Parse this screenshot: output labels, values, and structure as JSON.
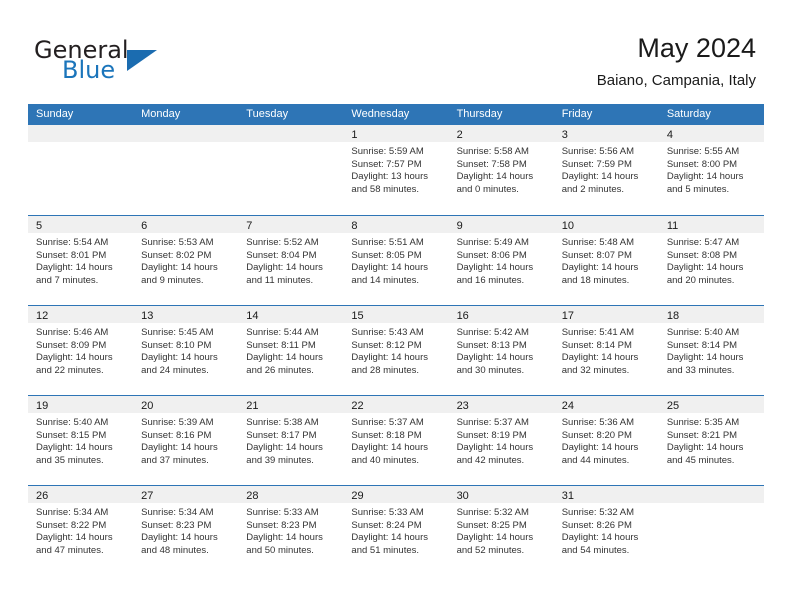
{
  "brand": {
    "word1": "General",
    "word2": "Blue",
    "logo_icon": "blue-triangle-icon"
  },
  "header": {
    "title": "May 2024",
    "subtitle": "Baiano, Campania, Italy"
  },
  "colors": {
    "header_blue": "#2e75b6",
    "brand_blue": "#1b75bb",
    "daynum_band": "#f0f0f0",
    "text": "#333333"
  },
  "calendar": {
    "day_headers": [
      "Sunday",
      "Monday",
      "Tuesday",
      "Wednesday",
      "Thursday",
      "Friday",
      "Saturday"
    ],
    "labels": {
      "sunrise": "Sunrise:",
      "sunset": "Sunset:",
      "daylight": "Daylight:"
    },
    "weeks": [
      [
        {
          "day": "",
          "empty": true
        },
        {
          "day": "",
          "empty": true
        },
        {
          "day": "",
          "empty": true
        },
        {
          "day": "1",
          "sunrise": "Sunrise: 5:59 AM",
          "sunset": "Sunset: 7:57 PM",
          "daylight1": "Daylight: 13 hours",
          "daylight2": "and 58 minutes."
        },
        {
          "day": "2",
          "sunrise": "Sunrise: 5:58 AM",
          "sunset": "Sunset: 7:58 PM",
          "daylight1": "Daylight: 14 hours",
          "daylight2": "and 0 minutes."
        },
        {
          "day": "3",
          "sunrise": "Sunrise: 5:56 AM",
          "sunset": "Sunset: 7:59 PM",
          "daylight1": "Daylight: 14 hours",
          "daylight2": "and 2 minutes."
        },
        {
          "day": "4",
          "sunrise": "Sunrise: 5:55 AM",
          "sunset": "Sunset: 8:00 PM",
          "daylight1": "Daylight: 14 hours",
          "daylight2": "and 5 minutes."
        }
      ],
      [
        {
          "day": "5",
          "sunrise": "Sunrise: 5:54 AM",
          "sunset": "Sunset: 8:01 PM",
          "daylight1": "Daylight: 14 hours",
          "daylight2": "and 7 minutes."
        },
        {
          "day": "6",
          "sunrise": "Sunrise: 5:53 AM",
          "sunset": "Sunset: 8:02 PM",
          "daylight1": "Daylight: 14 hours",
          "daylight2": "and 9 minutes."
        },
        {
          "day": "7",
          "sunrise": "Sunrise: 5:52 AM",
          "sunset": "Sunset: 8:04 PM",
          "daylight1": "Daylight: 14 hours",
          "daylight2": "and 11 minutes."
        },
        {
          "day": "8",
          "sunrise": "Sunrise: 5:51 AM",
          "sunset": "Sunset: 8:05 PM",
          "daylight1": "Daylight: 14 hours",
          "daylight2": "and 14 minutes."
        },
        {
          "day": "9",
          "sunrise": "Sunrise: 5:49 AM",
          "sunset": "Sunset: 8:06 PM",
          "daylight1": "Daylight: 14 hours",
          "daylight2": "and 16 minutes."
        },
        {
          "day": "10",
          "sunrise": "Sunrise: 5:48 AM",
          "sunset": "Sunset: 8:07 PM",
          "daylight1": "Daylight: 14 hours",
          "daylight2": "and 18 minutes."
        },
        {
          "day": "11",
          "sunrise": "Sunrise: 5:47 AM",
          "sunset": "Sunset: 8:08 PM",
          "daylight1": "Daylight: 14 hours",
          "daylight2": "and 20 minutes."
        }
      ],
      [
        {
          "day": "12",
          "sunrise": "Sunrise: 5:46 AM",
          "sunset": "Sunset: 8:09 PM",
          "daylight1": "Daylight: 14 hours",
          "daylight2": "and 22 minutes."
        },
        {
          "day": "13",
          "sunrise": "Sunrise: 5:45 AM",
          "sunset": "Sunset: 8:10 PM",
          "daylight1": "Daylight: 14 hours",
          "daylight2": "and 24 minutes."
        },
        {
          "day": "14",
          "sunrise": "Sunrise: 5:44 AM",
          "sunset": "Sunset: 8:11 PM",
          "daylight1": "Daylight: 14 hours",
          "daylight2": "and 26 minutes."
        },
        {
          "day": "15",
          "sunrise": "Sunrise: 5:43 AM",
          "sunset": "Sunset: 8:12 PM",
          "daylight1": "Daylight: 14 hours",
          "daylight2": "and 28 minutes."
        },
        {
          "day": "16",
          "sunrise": "Sunrise: 5:42 AM",
          "sunset": "Sunset: 8:13 PM",
          "daylight1": "Daylight: 14 hours",
          "daylight2": "and 30 minutes."
        },
        {
          "day": "17",
          "sunrise": "Sunrise: 5:41 AM",
          "sunset": "Sunset: 8:14 PM",
          "daylight1": "Daylight: 14 hours",
          "daylight2": "and 32 minutes."
        },
        {
          "day": "18",
          "sunrise": "Sunrise: 5:40 AM",
          "sunset": "Sunset: 8:14 PM",
          "daylight1": "Daylight: 14 hours",
          "daylight2": "and 33 minutes."
        }
      ],
      [
        {
          "day": "19",
          "sunrise": "Sunrise: 5:40 AM",
          "sunset": "Sunset: 8:15 PM",
          "daylight1": "Daylight: 14 hours",
          "daylight2": "and 35 minutes."
        },
        {
          "day": "20",
          "sunrise": "Sunrise: 5:39 AM",
          "sunset": "Sunset: 8:16 PM",
          "daylight1": "Daylight: 14 hours",
          "daylight2": "and 37 minutes."
        },
        {
          "day": "21",
          "sunrise": "Sunrise: 5:38 AM",
          "sunset": "Sunset: 8:17 PM",
          "daylight1": "Daylight: 14 hours",
          "daylight2": "and 39 minutes."
        },
        {
          "day": "22",
          "sunrise": "Sunrise: 5:37 AM",
          "sunset": "Sunset: 8:18 PM",
          "daylight1": "Daylight: 14 hours",
          "daylight2": "and 40 minutes."
        },
        {
          "day": "23",
          "sunrise": "Sunrise: 5:37 AM",
          "sunset": "Sunset: 8:19 PM",
          "daylight1": "Daylight: 14 hours",
          "daylight2": "and 42 minutes."
        },
        {
          "day": "24",
          "sunrise": "Sunrise: 5:36 AM",
          "sunset": "Sunset: 8:20 PM",
          "daylight1": "Daylight: 14 hours",
          "daylight2": "and 44 minutes."
        },
        {
          "day": "25",
          "sunrise": "Sunrise: 5:35 AM",
          "sunset": "Sunset: 8:21 PM",
          "daylight1": "Daylight: 14 hours",
          "daylight2": "and 45 minutes."
        }
      ],
      [
        {
          "day": "26",
          "sunrise": "Sunrise: 5:34 AM",
          "sunset": "Sunset: 8:22 PM",
          "daylight1": "Daylight: 14 hours",
          "daylight2": "and 47 minutes."
        },
        {
          "day": "27",
          "sunrise": "Sunrise: 5:34 AM",
          "sunset": "Sunset: 8:23 PM",
          "daylight1": "Daylight: 14 hours",
          "daylight2": "and 48 minutes."
        },
        {
          "day": "28",
          "sunrise": "Sunrise: 5:33 AM",
          "sunset": "Sunset: 8:23 PM",
          "daylight1": "Daylight: 14 hours",
          "daylight2": "and 50 minutes."
        },
        {
          "day": "29",
          "sunrise": "Sunrise: 5:33 AM",
          "sunset": "Sunset: 8:24 PM",
          "daylight1": "Daylight: 14 hours",
          "daylight2": "and 51 minutes."
        },
        {
          "day": "30",
          "sunrise": "Sunrise: 5:32 AM",
          "sunset": "Sunset: 8:25 PM",
          "daylight1": "Daylight: 14 hours",
          "daylight2": "and 52 minutes."
        },
        {
          "day": "31",
          "sunrise": "Sunrise: 5:32 AM",
          "sunset": "Sunset: 8:26 PM",
          "daylight1": "Daylight: 14 hours",
          "daylight2": "and 54 minutes."
        },
        {
          "day": "",
          "empty": true
        }
      ]
    ]
  }
}
